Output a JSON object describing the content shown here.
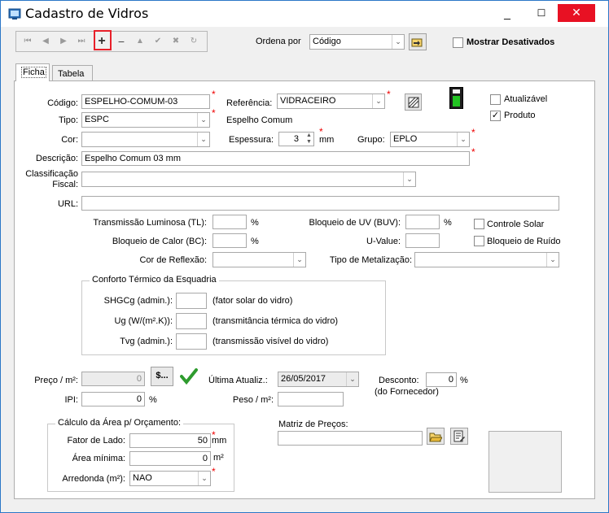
{
  "window": {
    "title": "Cadastro de Vidros",
    "minimize": "_",
    "maximize": "☐",
    "close": "✕"
  },
  "toolbar": {
    "first": "⏮",
    "prev": "◀",
    "next": "▶",
    "last": "⏭",
    "add": "+",
    "remove": "−",
    "up": "▲",
    "confirm": "✔",
    "cancel": "✖",
    "refresh": "↻",
    "order_label": "Ordena por",
    "order_value": "Código",
    "show_disabled": "Mostrar Desativados"
  },
  "tabs": [
    {
      "label": "Ficha"
    },
    {
      "label": "Tabela"
    }
  ],
  "form": {
    "codigo_label": "Código:",
    "codigo_value": "ESPELHO-COMUM-03",
    "referencia_label": "Referência:",
    "referencia_value": "VIDRACEIRO",
    "tipo_label": "Tipo:",
    "tipo_value": "ESPC",
    "tipo_desc": "Espelho Comum",
    "cor_label": "Cor:",
    "cor_value": "",
    "espessura_label": "Espessura:",
    "espessura_value": "3",
    "espessura_unit": "mm",
    "grupo_label": "Grupo:",
    "grupo_value": "EPLO",
    "descricao_label": "Descrição:",
    "descricao_value": "Espelho Comum 03 mm",
    "classificacao_label_1": "Classificação",
    "classificacao_label_2": "Fiscal:",
    "classificacao_value": "",
    "url_label": "URL:",
    "url_value": "",
    "atualizavel_label": "Atualizável",
    "produto_label": "Produto",
    "tl_label": "Transmissão Luminosa (TL):",
    "tl_unit": "%",
    "buv_label": "Bloqueio de UV (BUV):",
    "buv_unit": "%",
    "controle_solar_label": "Controle Solar",
    "bc_label": "Bloqueio de Calor (BC):",
    "bc_unit": "%",
    "uvalue_label": "U-Value:",
    "bloqueio_ruido_label": "Bloqueio de Ruído",
    "reflexao_label": "Cor de Reflexão:",
    "metalizacao_label": "Tipo de Metalização:"
  },
  "conforto": {
    "title": "Conforto Térmico da Esquadria",
    "shgcg_label": "SHGCg (admin.):",
    "shgcg_hint": "(fator solar do vidro)",
    "ug_label": "Ug (W/(m².K)):",
    "ug_hint": "(transmitância térmica do vidro)",
    "tvg_label": "Tvg (admin.):",
    "tvg_hint": "(transmissão visível do vidro)"
  },
  "preco": {
    "preco_label": "Preço / m²:",
    "preco_value": "0",
    "currency_btn": "$...",
    "ultima_label": "Última Atualiz.:",
    "ultima_value": "26/05/2017",
    "desconto_label": "Desconto:",
    "desconto_value": "0",
    "desconto_unit": "%",
    "fornecedor_label": "(do Fornecedor)",
    "ipi_label": "IPI:",
    "ipi_value": "0",
    "ipi_unit": "%",
    "peso_label": "Peso / m²:",
    "peso_value": ""
  },
  "calculo": {
    "title": "Cálculo da Área p/ Orçamento:",
    "fator_label": "Fator de Lado:",
    "fator_value": "50",
    "fator_unit": "mm",
    "area_label": "Área mínima:",
    "area_value": "0",
    "area_unit": "m²",
    "arred_label": "Arredonda (m²):",
    "arred_value": "NAO"
  },
  "matriz": {
    "label": "Matriz de Preços:",
    "value": ""
  },
  "colors": {
    "accent": "#2b77c7",
    "close_red": "#e81123",
    "highlight": "#e8202a",
    "required": "#ee0000",
    "indicator_green": "#22c322"
  }
}
